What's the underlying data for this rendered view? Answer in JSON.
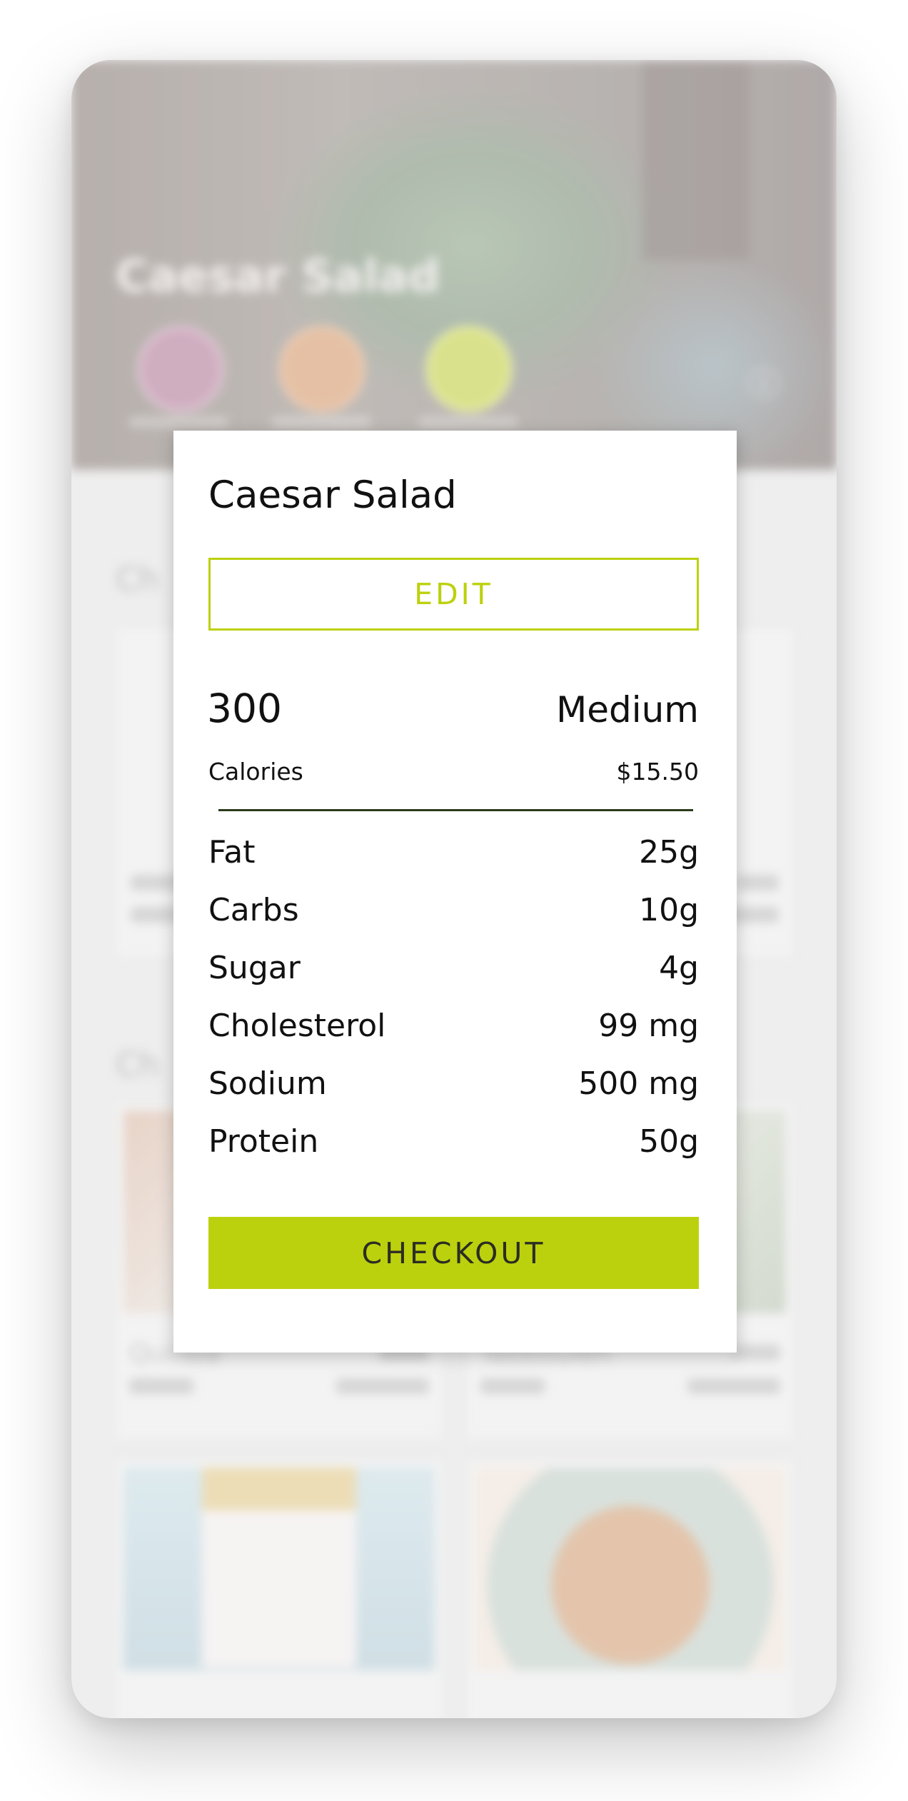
{
  "background": {
    "hero_title": "Caesar Salad",
    "hero_icon": "info-icon",
    "colors": {
      "hero": "#8a7f79",
      "badge_1": "#b27c9a",
      "badge_2": "#d59a6d",
      "badge_3": "#c3cf46"
    }
  },
  "modal": {
    "title": "Caesar Salad",
    "edit_label": "EDIT",
    "calories_value": "300",
    "calories_label": "Calories",
    "size": "Medium",
    "price": "$15.50",
    "nutrition": [
      {
        "label": "Fat",
        "value": "25g"
      },
      {
        "label": "Carbs",
        "value": "10g"
      },
      {
        "label": "Sugar",
        "value": "4g"
      },
      {
        "label": "Cholesterol",
        "value": "99 mg"
      },
      {
        "label": "Sodium",
        "value": "500 mg"
      },
      {
        "label": "Protein",
        "value": "50g"
      }
    ],
    "checkout_label": "CHECKOUT",
    "colors": {
      "accent": "#bcd10d",
      "divider": "#2a3a1c",
      "checkout_text": "#2b2d23"
    }
  }
}
